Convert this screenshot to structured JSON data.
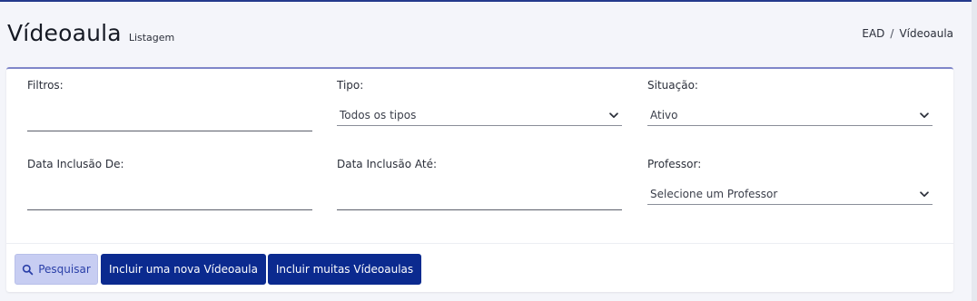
{
  "header": {
    "title": "Vídeoaula",
    "subtitle": "Listagem"
  },
  "breadcrumb": {
    "items": [
      "EAD",
      "Vídeoaula"
    ],
    "separator": "/"
  },
  "filters": {
    "filtros": {
      "label": "Filtros:",
      "value": ""
    },
    "tipo": {
      "label": "Tipo:",
      "selected": "Todos os tipos"
    },
    "situacao": {
      "label": "Situação:",
      "selected": "Ativo"
    },
    "data_de": {
      "label": "Data Inclusão De:",
      "value": ""
    },
    "data_ate": {
      "label": "Data Inclusão Até:",
      "value": ""
    },
    "professor": {
      "label": "Professor:",
      "selected": "Selecione um Professor"
    }
  },
  "actions": {
    "search_label": "Pesquisar",
    "new_label": "Incluir uma nova Vídeoaula",
    "many_label": "Incluir muitas Vídeoaulas"
  },
  "icons": {
    "search": "search-icon",
    "chevron": "chevron-down-icon"
  },
  "colors": {
    "primary": "#0b2a8f",
    "search_bg": "#c7cdf2",
    "card_top_border": "#7f86c9",
    "top_line": "#243a8c"
  }
}
